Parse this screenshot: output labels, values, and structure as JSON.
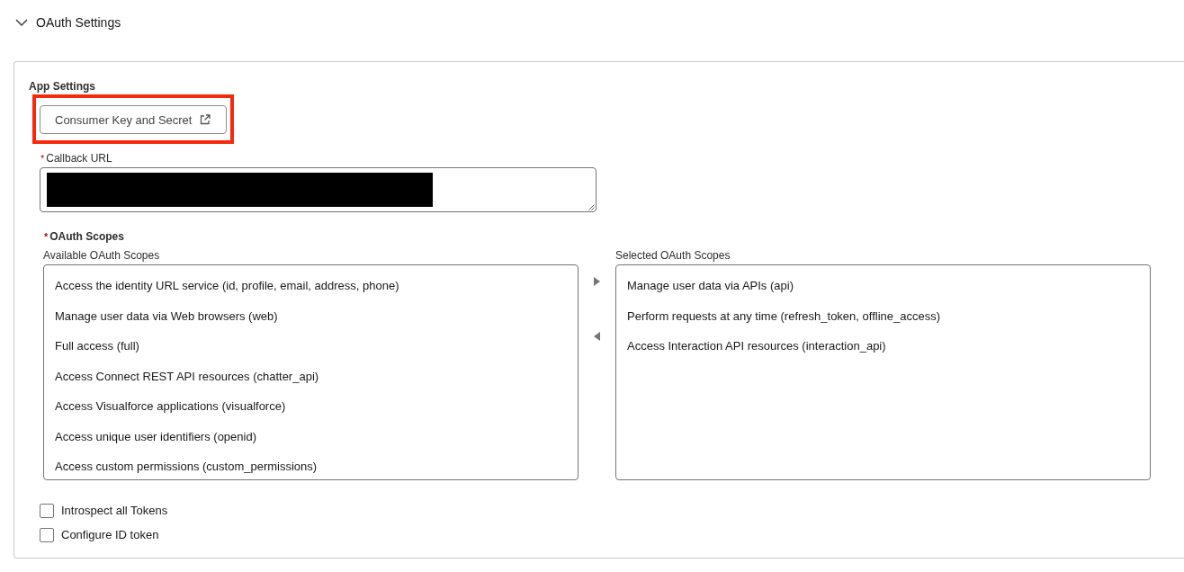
{
  "section": {
    "title": "OAuth Settings",
    "expanded": true
  },
  "app_settings": {
    "heading": "App Settings",
    "consumer_key_button": {
      "label": "Consumer Key and Secret",
      "highlighted": true
    }
  },
  "callback_url": {
    "required_mark": "*",
    "label": "Callback URL",
    "redacted": true
  },
  "oauth_scopes": {
    "required_mark": "*",
    "label": "OAuth Scopes",
    "available": {
      "label": "Available OAuth Scopes",
      "items": [
        {
          "label": "Access the identity URL service (id, profile, email, address, phone)",
          "selected": false
        },
        {
          "label": "Manage user data via Web browsers (web)",
          "selected": false
        },
        {
          "label": "Full access (full)",
          "selected": false
        },
        {
          "label": "Access Connect REST API resources (chatter_api)",
          "selected": false
        },
        {
          "label": "Access Visualforce applications (visualforce)",
          "selected": false
        },
        {
          "label": "Access unique user identifiers (openid)",
          "selected": false
        },
        {
          "label": "Access custom permissions (custom_permissions)",
          "selected": false
        }
      ]
    },
    "selected": {
      "label": "Selected OAuth Scopes",
      "items": [
        {
          "label": "Manage user data via APIs (api)",
          "selected": false
        },
        {
          "label": "Perform requests at any time (refresh_token, offline_access)",
          "selected": false
        },
        {
          "label": "Access Interaction API resources (interaction_api)",
          "selected": false
        }
      ]
    }
  },
  "options": [
    {
      "label": "Introspect all Tokens",
      "checked": false
    },
    {
      "label": "Configure ID token",
      "checked": false
    }
  ]
}
